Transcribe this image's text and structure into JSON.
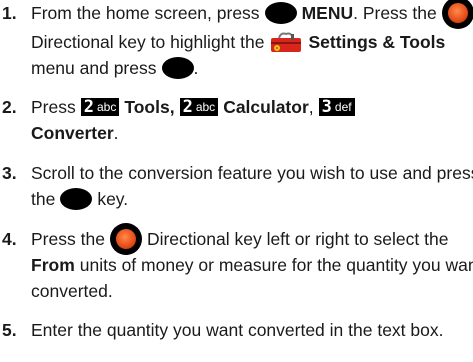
{
  "steps": [
    {
      "number": "1.",
      "line1": {
        "t1": "From the home screen, press",
        "menu": "MENU",
        "t2": ". Press the"
      },
      "line2": {
        "t1": "Directional key to highlight the",
        "settings": "Settings & Tools"
      },
      "line3": {
        "t1": "menu and press",
        "t2": "."
      }
    },
    {
      "number": "2.",
      "line1": {
        "t1": "Press",
        "key1": {
          "digit": "2",
          "letters": "abc"
        },
        "tools": "Tools,",
        "key2": {
          "digit": "2",
          "letters": "abc"
        },
        "calculator": "Calculator",
        "comma": ",",
        "key3": {
          "digit": "3",
          "letters": "def"
        }
      },
      "line2": {
        "converter": "Converter",
        "t1": "."
      }
    },
    {
      "number": "3.",
      "line1": "Scroll to the conversion feature you wish to use and press",
      "line2": {
        "t1": "the",
        "t2": "key."
      }
    },
    {
      "number": "4.",
      "line1": {
        "t1": "Press the",
        "t2": "Directional key left or right to select the"
      },
      "line2": {
        "from": "From",
        "t1": "units of money or measure for the quantity you want"
      },
      "line3": "converted."
    },
    {
      "number": "5.",
      "line1": "Enter the quantity you want converted in the text box."
    }
  ],
  "icons": {
    "ok": "ok-key-icon",
    "nav": "directional-key-icon",
    "toolbox": "settings-tools-toolbox-icon"
  },
  "colors": {
    "text": "#1a1a1a",
    "key": "#000000",
    "nav_center": "#e8501c",
    "toolbox": "#d8261c"
  }
}
